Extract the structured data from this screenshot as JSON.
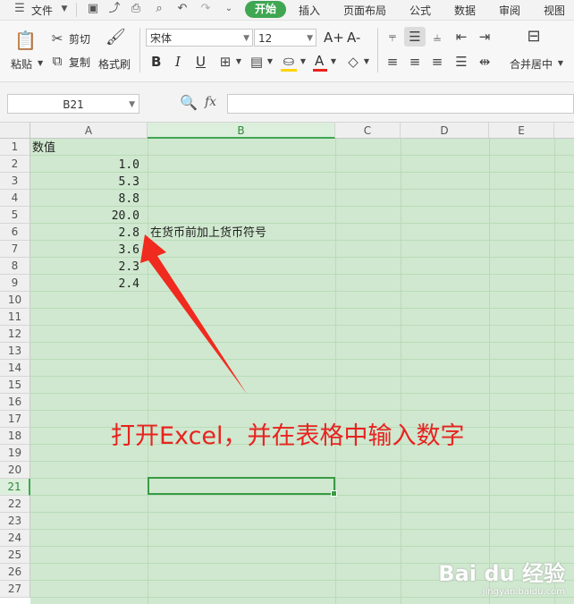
{
  "menubar": {
    "file": "文件",
    "tabs": [
      "开始",
      "插入",
      "页面布局",
      "公式",
      "数据",
      "审阅",
      "视图"
    ],
    "active_tab": "开始"
  },
  "ribbon": {
    "paste": "粘贴",
    "cut": "剪切",
    "copy": "复制",
    "format_painter": "格式刷",
    "font_name": "宋体",
    "font_size": "12",
    "merge_center": "合并居中",
    "bold": "B",
    "italic": "I",
    "underline": "U",
    "grow_font": "A+",
    "shrink_font": "A-",
    "font_color_letter": "A",
    "font_color": "#e8231f",
    "fill_color": "#ffd400"
  },
  "formula_bar": {
    "name_box": "B21",
    "fx": "fx",
    "value": ""
  },
  "grid": {
    "columns": [
      "A",
      "B",
      "C",
      "D",
      "E"
    ],
    "selected_column": "B",
    "rows": [
      "1",
      "2",
      "3",
      "4",
      "5",
      "6",
      "7",
      "8",
      "9",
      "10",
      "11",
      "12",
      "13",
      "14",
      "15",
      "16",
      "17",
      "18",
      "19",
      "20",
      "21",
      "22",
      "23",
      "24",
      "25",
      "26",
      "27"
    ],
    "selected_row": "21",
    "selected_cell": "B21",
    "cells": {
      "A1": "数值",
      "A2": "1.0",
      "A3": "5.3",
      "A4": "8.8",
      "A5": "20.0",
      "A6": "2.8",
      "A7": "3.6",
      "A8": "2.3",
      "A9": "2.4",
      "B6": "在货币前加上货币符号"
    }
  },
  "annotation": {
    "text": "打开Excel，并在表格中输入数字",
    "color": "#e8231f"
  },
  "watermark": {
    "brand": "Bai du 经验",
    "url": "jingyan.baidu.com"
  }
}
